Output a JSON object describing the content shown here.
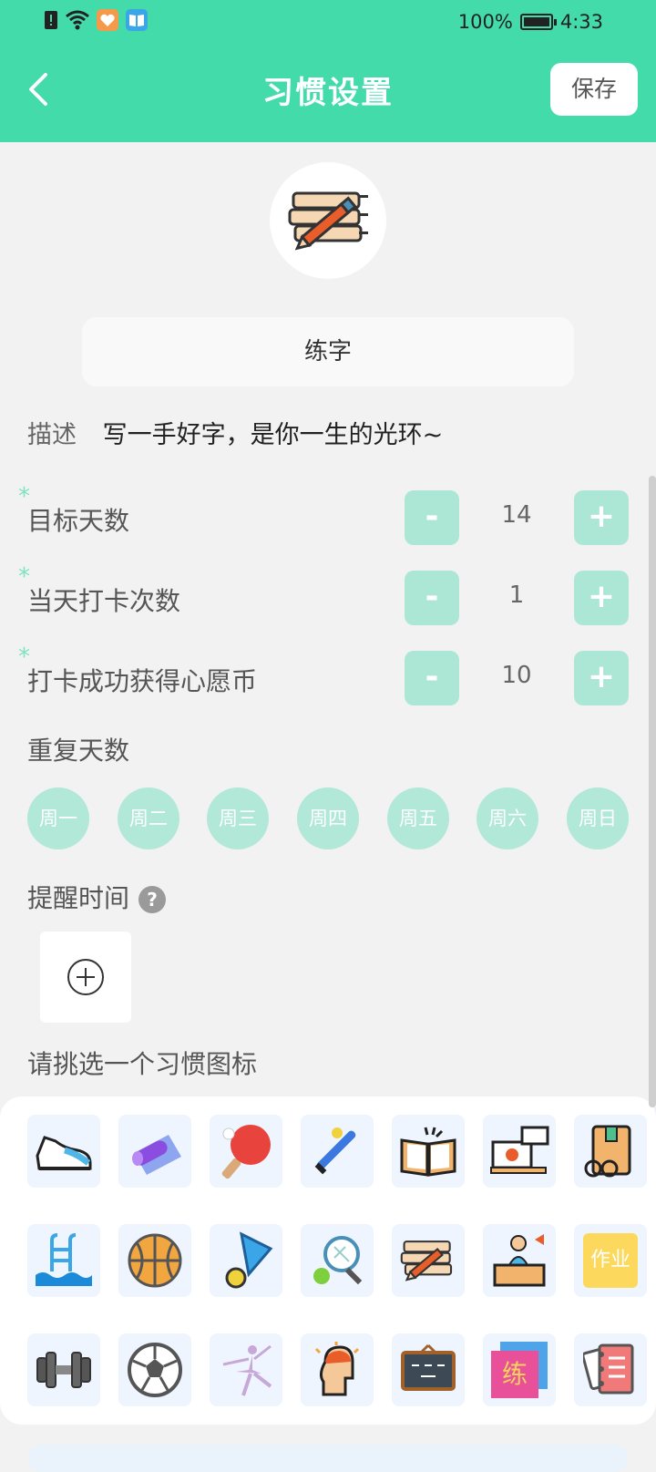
{
  "status_bar": {
    "battery": "100%",
    "time": "4:33"
  },
  "header": {
    "title": "习惯设置",
    "save_label": "保存"
  },
  "habit": {
    "name": "练字"
  },
  "description": {
    "label": "描述",
    "text": "写一手好字，是你一生的光环~"
  },
  "steppers": [
    {
      "label": "目标天数",
      "value": "14",
      "minus": "-",
      "plus": "+"
    },
    {
      "label": "当天打卡次数",
      "value": "1",
      "minus": "-",
      "plus": "+"
    },
    {
      "label": "打卡成功获得心愿币",
      "value": "10",
      "minus": "-",
      "plus": "+"
    }
  ],
  "required_mark": "*",
  "repeat": {
    "label": "重复天数",
    "days": [
      "周一",
      "周二",
      "周三",
      "周四",
      "周五",
      "周六",
      "周日"
    ]
  },
  "reminder": {
    "label": "提醒时间",
    "help": "?"
  },
  "icon_picker": {
    "label": "请挑选一个习惯图标",
    "homework_text": "作业",
    "practice_text": "练",
    "icons": [
      "sneaker-icon",
      "yoga-mat-icon",
      "ping-pong-icon",
      "baseball-bat-icon",
      "open-book-icon",
      "online-class-icon",
      "school-bag-icon",
      "swimming-icon",
      "basketball-icon",
      "badminton-icon",
      "tennis-icon",
      "calligraphy-icon",
      "teacher-desk-icon",
      "homework-icon",
      "dumbbell-icon",
      "soccer-icon",
      "ballet-icon",
      "thinking-icon",
      "blackboard-icon",
      "practice-card-icon",
      "notebook-icon"
    ]
  },
  "colors": {
    "accent": "#44dbab",
    "button_light": "#abe7d4",
    "day_circle": "#b2e8d8"
  }
}
